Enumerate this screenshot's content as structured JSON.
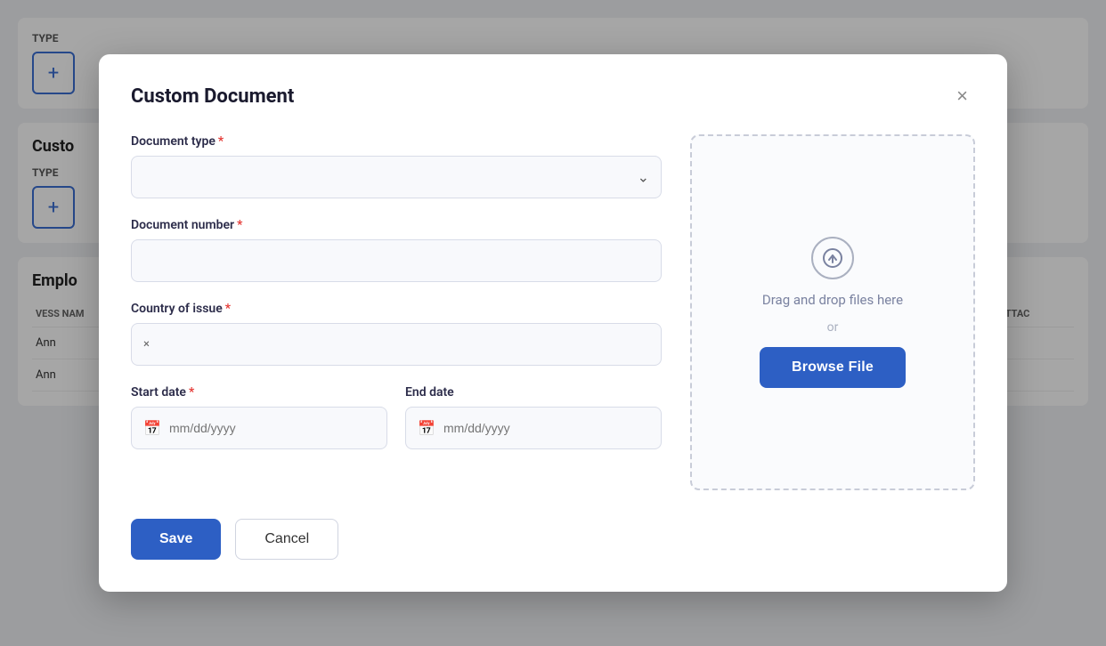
{
  "background": {
    "sections": [
      {
        "label": "TYPE",
        "add_symbol": "+"
      },
      {
        "title": "Custo",
        "label": "TYPE",
        "add_symbol": "+"
      },
      {
        "title": "Emplo",
        "table": {
          "columns": [
            "VESS NAM",
            "",
            "ATTAC"
          ],
          "rows": [
            [
              "Ann",
              "",
              ""
            ],
            [
              "Ann",
              "",
              ""
            ]
          ]
        }
      }
    ]
  },
  "modal": {
    "title": "Custom Document",
    "close_label": "×",
    "form": {
      "document_type": {
        "label": "Document type",
        "required": true,
        "placeholder": "",
        "options": []
      },
      "document_number": {
        "label": "Document number",
        "required": true,
        "placeholder": ""
      },
      "country_of_issue": {
        "label": "Country of issue",
        "required": true,
        "value": "×"
      },
      "start_date": {
        "label": "Start date",
        "required": true,
        "placeholder": "mm/dd/yyyy"
      },
      "end_date": {
        "label": "End date",
        "required": false,
        "placeholder": "mm/dd/yyyy"
      }
    },
    "upload": {
      "drag_text": "Drag and drop files here",
      "or_text": "or",
      "browse_label": "Browse File"
    },
    "footer": {
      "save_label": "Save",
      "cancel_label": "Cancel"
    }
  }
}
